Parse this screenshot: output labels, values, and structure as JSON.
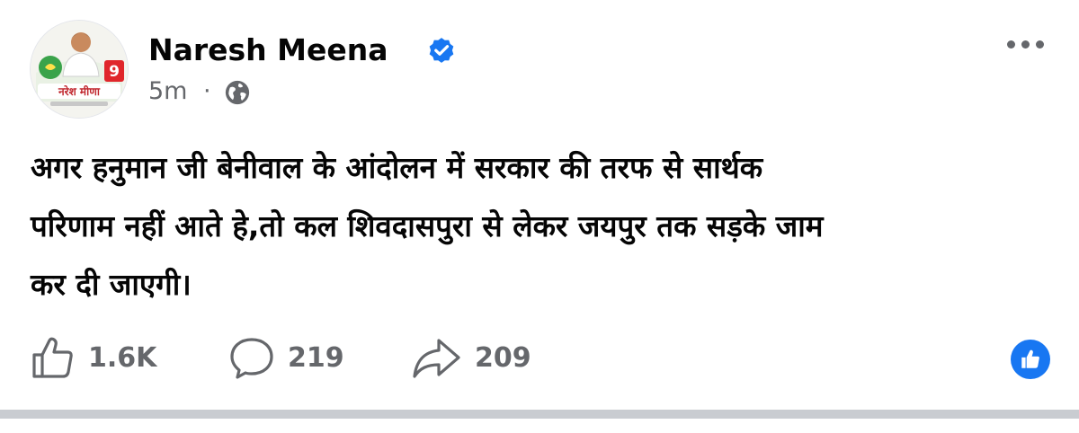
{
  "post": {
    "author": {
      "name": "Naresh Meena",
      "verified_icon": "verified-badge-icon",
      "avatar_caption": "नरेश मीणा",
      "avatar_number": "9"
    },
    "time": "5m",
    "separator": "·",
    "audience_icon": "globe-icon",
    "more_icon": "more-options-icon",
    "text_lines": [
      "अगर हनुमान जी बेनीवाल के आंदोलन में सरकार की तरफ से सार्थक",
      "परिणाम नहीं आते हे,तो कल शिवदासपुरा से लेकर जयपुर तक सड़के जाम",
      "कर दी जाएगी।"
    ],
    "actions": {
      "like": {
        "icon": "like-icon",
        "count": "1.6K"
      },
      "comment": {
        "icon": "comment-icon",
        "count": "219"
      },
      "share": {
        "icon": "share-icon",
        "count": "209"
      }
    },
    "reaction_icon": "like-reaction-icon"
  },
  "colors": {
    "text": "#050505",
    "secondary": "#65676b",
    "brand_blue": "#1877f2",
    "divider": "#c9ccd1"
  }
}
